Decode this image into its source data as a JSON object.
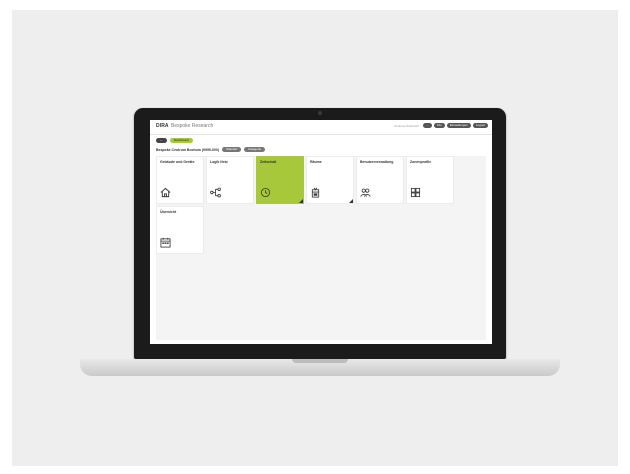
{
  "app": {
    "logo": "DIRA",
    "name": "Bespoke Research",
    "user_text": "Andreas Zucknicki",
    "header_buttons": [
      "···",
      "Info",
      "Einstellungen",
      "Logout"
    ]
  },
  "toolbar": {
    "back_label": "←",
    "active_label": "Dashboard"
  },
  "filter": {
    "title": "Bespoke Centrum Bochum (9999-000)",
    "chips": [
      "Standort",
      "Kategorie"
    ]
  },
  "tiles": [
    {
      "label": "Gebäude und Geräte",
      "icon": "house-icon"
    },
    {
      "label": "Logik Netz",
      "icon": "network-icon"
    },
    {
      "label": "Zeitschalt",
      "icon": "clock-icon"
    },
    {
      "label": "Räume",
      "icon": "door-icon"
    },
    {
      "label": "Benutzerverwaltung",
      "icon": "users-icon"
    },
    {
      "label": "Zonenprofile",
      "icon": "profiles-icon"
    },
    {
      "label": "Übersicht",
      "icon": "calendar-icon"
    }
  ],
  "colors": {
    "accent": "#a6c83a",
    "dark": "#1b1b1b"
  }
}
